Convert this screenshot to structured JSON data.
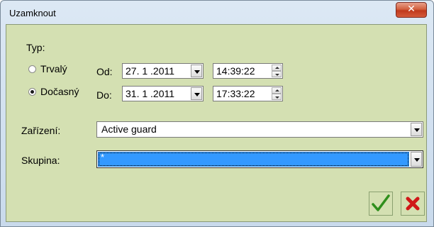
{
  "window": {
    "title": "Uzamknout",
    "close_icon": "close-icon"
  },
  "typ": {
    "label": "Typ:",
    "options": [
      {
        "label": "Trvalý",
        "checked": false
      },
      {
        "label": "Dočasný",
        "checked": true
      }
    ]
  },
  "od": {
    "label": "Od:",
    "date": "27. 1 .2011",
    "time": "14:39:22"
  },
  "do": {
    "label": "Do:",
    "date": "31. 1 .2011",
    "time": "17:33:22"
  },
  "zarizeni": {
    "label": "Zařízení:",
    "value": "Active guard"
  },
  "skupina": {
    "label": "Skupina:",
    "value": "*"
  },
  "colors": {
    "accept": "#2f8f1c",
    "cancel": "#d01818",
    "panel": "#d4e0b2",
    "selection": "#3399ff"
  }
}
